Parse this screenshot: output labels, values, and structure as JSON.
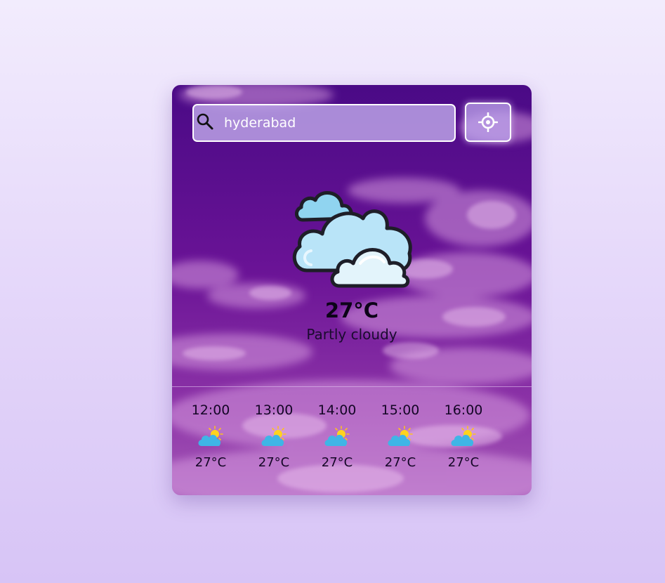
{
  "search": {
    "value": "hyderabad",
    "icon": "search-icon"
  },
  "locate": {
    "icon": "crosshair-icon"
  },
  "current": {
    "icon": "partly-cloudy-icon",
    "temperature": "27°C",
    "condition": "Partly cloudy"
  },
  "hourly": [
    {
      "time": "12:00",
      "icon": "sun-behind-cloud-icon",
      "temp": "27°C"
    },
    {
      "time": "13:00",
      "icon": "sun-behind-cloud-icon",
      "temp": "27°C"
    },
    {
      "time": "14:00",
      "icon": "sun-behind-cloud-icon",
      "temp": "27°C"
    },
    {
      "time": "15:00",
      "icon": "sun-behind-cloud-icon",
      "temp": "27°C"
    },
    {
      "time": "16:00",
      "icon": "sun-behind-cloud-icon",
      "temp": "27°C"
    }
  ],
  "colors": {
    "page_background": "#e6d9fa",
    "sky_top": "#4e0a86",
    "sky_bottom": "#a24fb8",
    "cloud_fill": "#bfe7f9",
    "sun": "#ffd21f"
  }
}
